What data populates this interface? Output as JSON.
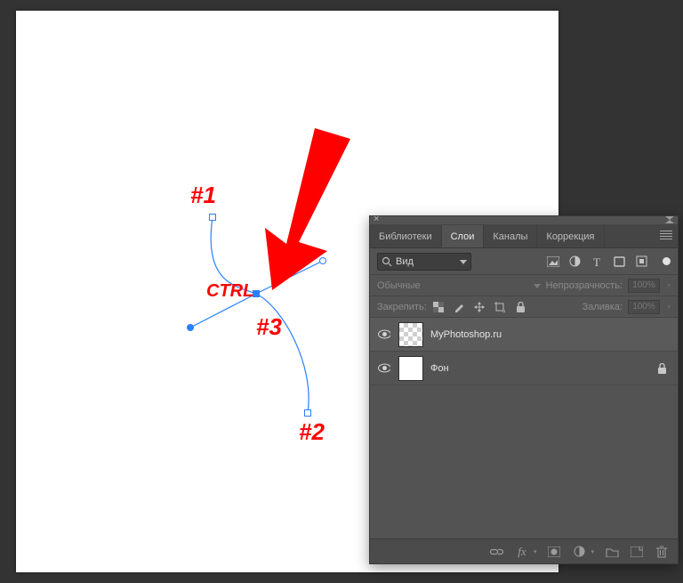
{
  "canvas": {
    "annotations": {
      "a1": "#1",
      "a2": "#2",
      "a3": "#3",
      "ctrl": "CTRL"
    }
  },
  "panel": {
    "tabs": {
      "libraries": "Библиотеки",
      "layers": "Слои",
      "channels": "Каналы",
      "adjustments": "Коррекция"
    },
    "filter": {
      "search_icon": "search-icon",
      "kind_value": "Вид"
    },
    "blend": {
      "mode": "Обычные",
      "opacity_label": "Непрозрачность:",
      "opacity_value": "100%"
    },
    "lock": {
      "label": "Закрепить:",
      "fill_label": "Заливка:",
      "fill_value": "100%"
    },
    "layers": [
      {
        "name": "MyPhotoshop.ru",
        "locked": false
      },
      {
        "name": "Фон",
        "locked": true
      }
    ]
  }
}
